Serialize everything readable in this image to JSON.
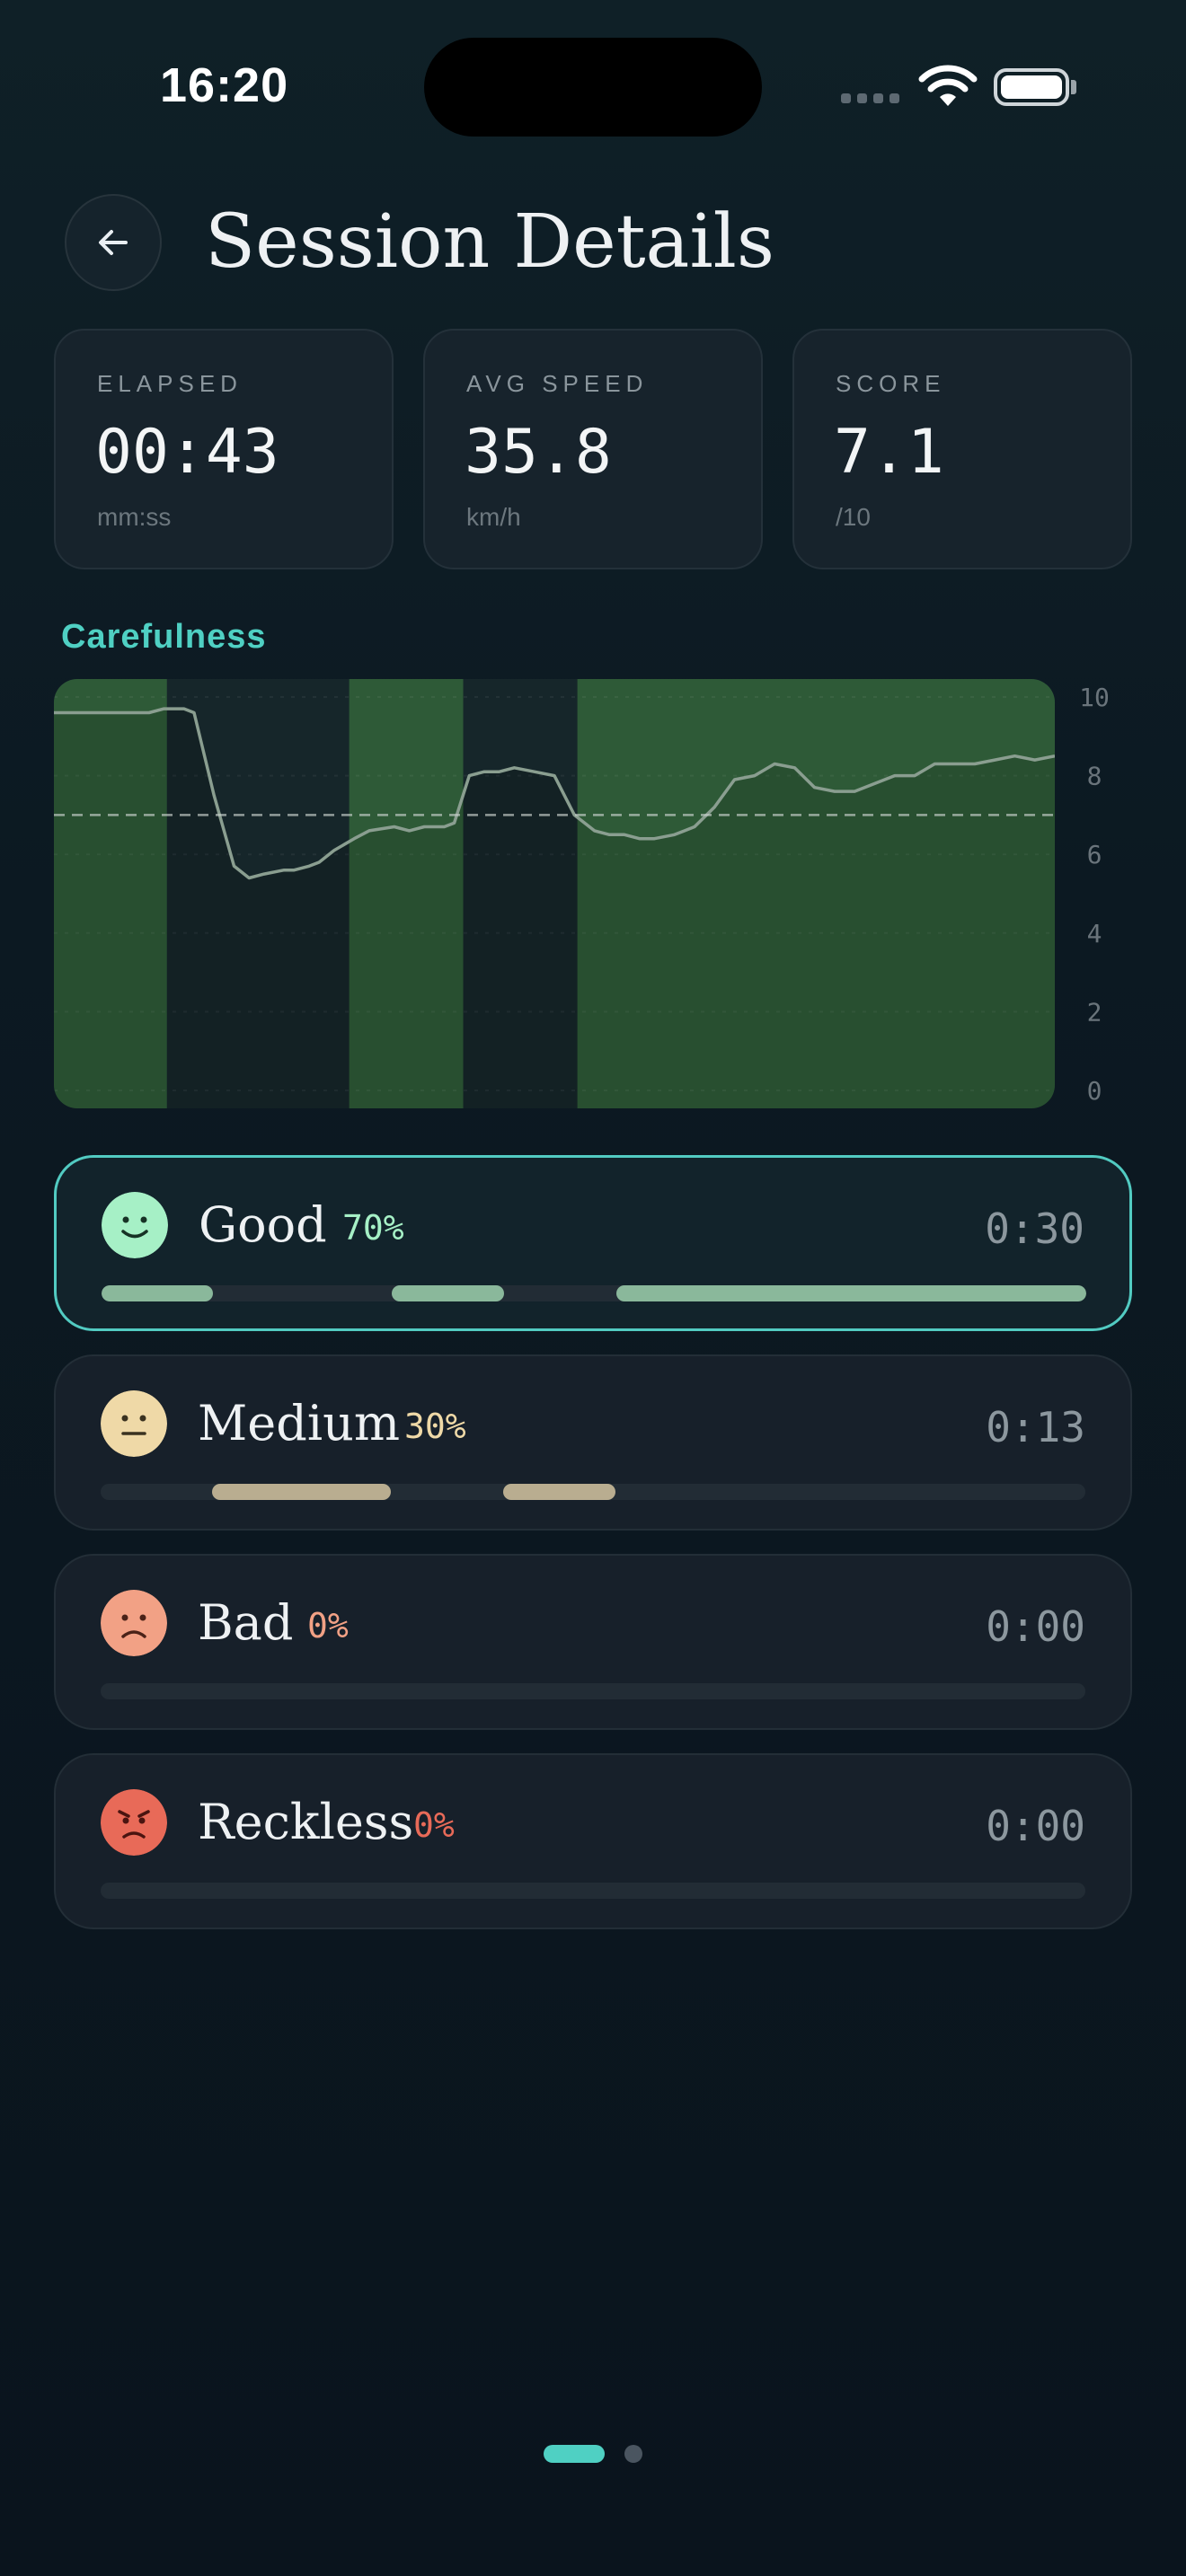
{
  "status_bar": {
    "time": "16:20",
    "icons": [
      "cellular-signal-icon",
      "wifi-icon",
      "battery-icon"
    ]
  },
  "header": {
    "back_icon": "arrow-left-icon",
    "title": "Session Details"
  },
  "stats": [
    {
      "label": "ELAPSED",
      "value": "00:43",
      "unit": "mm:ss"
    },
    {
      "label": "AVG SPEED",
      "value": "35.8",
      "unit": "km/h"
    },
    {
      "label": "SCORE",
      "value": "7.1",
      "unit": "/10"
    }
  ],
  "chart_title": "Carefulness",
  "chart_data": {
    "type": "line",
    "title": "Carefulness",
    "ylim": [
      0,
      10
    ],
    "yticks": [
      "0",
      "2",
      "4",
      "6",
      "8",
      "10"
    ],
    "threshold": 7,
    "grid": true,
    "x": [
      0,
      3,
      6,
      8.6,
      9.5,
      11,
      12,
      13,
      14,
      16,
      18,
      19.5,
      21,
      23,
      24,
      25.5,
      26.5,
      28,
      30,
      31.5,
      34,
      35.5,
      37,
      39,
      40,
      41.5,
      43,
      44.5,
      46,
      48,
      50,
      52,
      54,
      55.5,
      57,
      58.5,
      60,
      62,
      64,
      66,
      68,
      70,
      72,
      74,
      76,
      78,
      80,
      82,
      84,
      86,
      88,
      90,
      92,
      94,
      96,
      98,
      100
    ],
    "values": [
      9.6,
      9.6,
      9.6,
      9.6,
      9.6,
      9.7,
      9.7,
      9.7,
      9.6,
      7.5,
      5.7,
      5.4,
      5.5,
      5.6,
      5.6,
      5.7,
      5.8,
      6.1,
      6.4,
      6.6,
      6.7,
      6.6,
      6.7,
      6.7,
      6.8,
      8.0,
      8.1,
      8.1,
      8.2,
      8.1,
      8.0,
      7.0,
      6.6,
      6.5,
      6.5,
      6.4,
      6.4,
      6.5,
      6.7,
      7.2,
      7.9,
      8.0,
      8.3,
      8.2,
      7.7,
      7.6,
      7.6,
      7.8,
      8.0,
      8.0,
      8.3,
      8.3,
      8.3,
      8.4,
      8.5,
      8.4,
      8.5
    ],
    "bands": [
      {
        "start": 0,
        "end": 11.3,
        "category": "Good"
      },
      {
        "start": 11.3,
        "end": 29.5,
        "category": "Medium"
      },
      {
        "start": 29.5,
        "end": 40.9,
        "category": "Good"
      },
      {
        "start": 40.9,
        "end": 52.3,
        "category": "Medium"
      },
      {
        "start": 52.3,
        "end": 100,
        "category": "Good"
      }
    ]
  },
  "categories": [
    {
      "name": "Good",
      "percent": "70%",
      "time": "0:30",
      "icon": "smile-face-icon",
      "color": "#a6f0c6",
      "bar_color": "#8ab89b",
      "active": true,
      "segments": [
        {
          "start": 0,
          "end": 11.3
        },
        {
          "start": 29.5,
          "end": 40.9
        },
        {
          "start": 52.3,
          "end": 100
        }
      ]
    },
    {
      "name": "Medium",
      "percent": "30%",
      "time": "0:13",
      "icon": "neutral-face-icon",
      "color": "#efd9a7",
      "bar_color": "#b9ad90",
      "active": false,
      "segments": [
        {
          "start": 11.3,
          "end": 29.5
        },
        {
          "start": 40.9,
          "end": 52.3
        }
      ]
    },
    {
      "name": "Bad",
      "percent": "0%",
      "time": "0:00",
      "icon": "frown-face-icon",
      "color": "#f2a185",
      "bar_color": "#c08572",
      "active": false,
      "segments": []
    },
    {
      "name": "Reckless",
      "percent": "0%",
      "time": "0:00",
      "icon": "angry-face-icon",
      "color": "#e86a58",
      "bar_color": "#c05a4b",
      "active": false,
      "segments": []
    }
  ],
  "colors": {
    "accent": "#4fd0c3",
    "good_band": "#2e5a37",
    "medium_band": "#16262a"
  },
  "pager": {
    "count": 2,
    "active_index": 0
  }
}
